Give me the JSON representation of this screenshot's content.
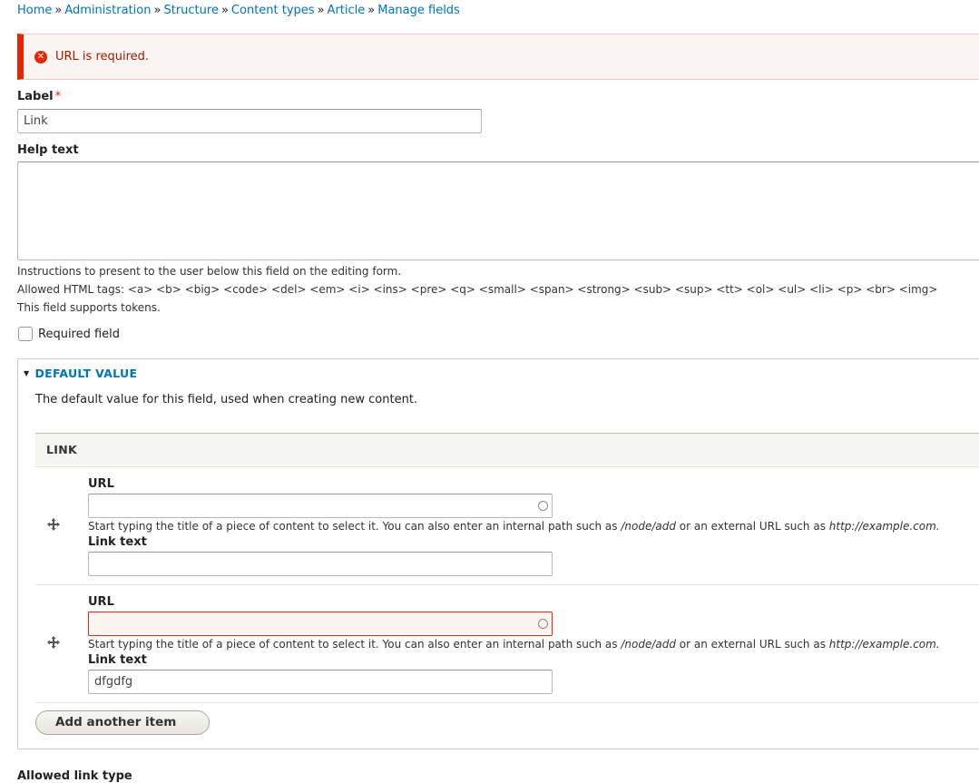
{
  "breadcrumb": [
    "Home",
    "Administration",
    "Structure",
    "Content types",
    "Article",
    "Manage fields"
  ],
  "breadcrumb_separator": "»",
  "message": {
    "text": "URL is required.",
    "icon": "error-icon",
    "color": "#e62600"
  },
  "label_field": {
    "label": "Label",
    "required_mark": "*",
    "value": "Link"
  },
  "help_text": {
    "label": "Help text",
    "value": "",
    "description_lines": [
      "Instructions to present to the user below this field on the editing form.",
      "Allowed HTML tags: <a> <b> <big> <code> <del> <em> <i> <ins> <pre> <q> <small> <span> <strong> <sub> <sup> <tt> <ol> <ul> <li> <p> <br> <img>",
      "This field supports tokens."
    ]
  },
  "required_checkbox": {
    "label": "Required field",
    "checked": false
  },
  "default_value": {
    "summary": "DEFAULT VALUE",
    "description": "The default value for this field, used when creating new content.",
    "table_header": "LINK",
    "items": [
      {
        "url_label": "URL",
        "url_value": "",
        "url_error": false,
        "desc_start": "Start typing the title of a piece of content to select it. You can also enter an internal path such as ",
        "desc_path": "/node/add",
        "desc_mid": " or an external URL such as ",
        "desc_url": "http://example.com.",
        "link_text_label": "Link text",
        "link_text_value": ""
      },
      {
        "url_label": "URL",
        "url_value": "",
        "url_error": true,
        "desc_start": "Start typing the title of a piece of content to select it. You can also enter an internal path such as ",
        "desc_path": "/node/add",
        "desc_mid": " or an external URL such as ",
        "desc_url": "http://example.com.",
        "link_text_label": "Link text",
        "link_text_value": "dfgdfg"
      }
    ],
    "add_button": "Add another item"
  },
  "bottom_partial_label": "Allowed link type"
}
